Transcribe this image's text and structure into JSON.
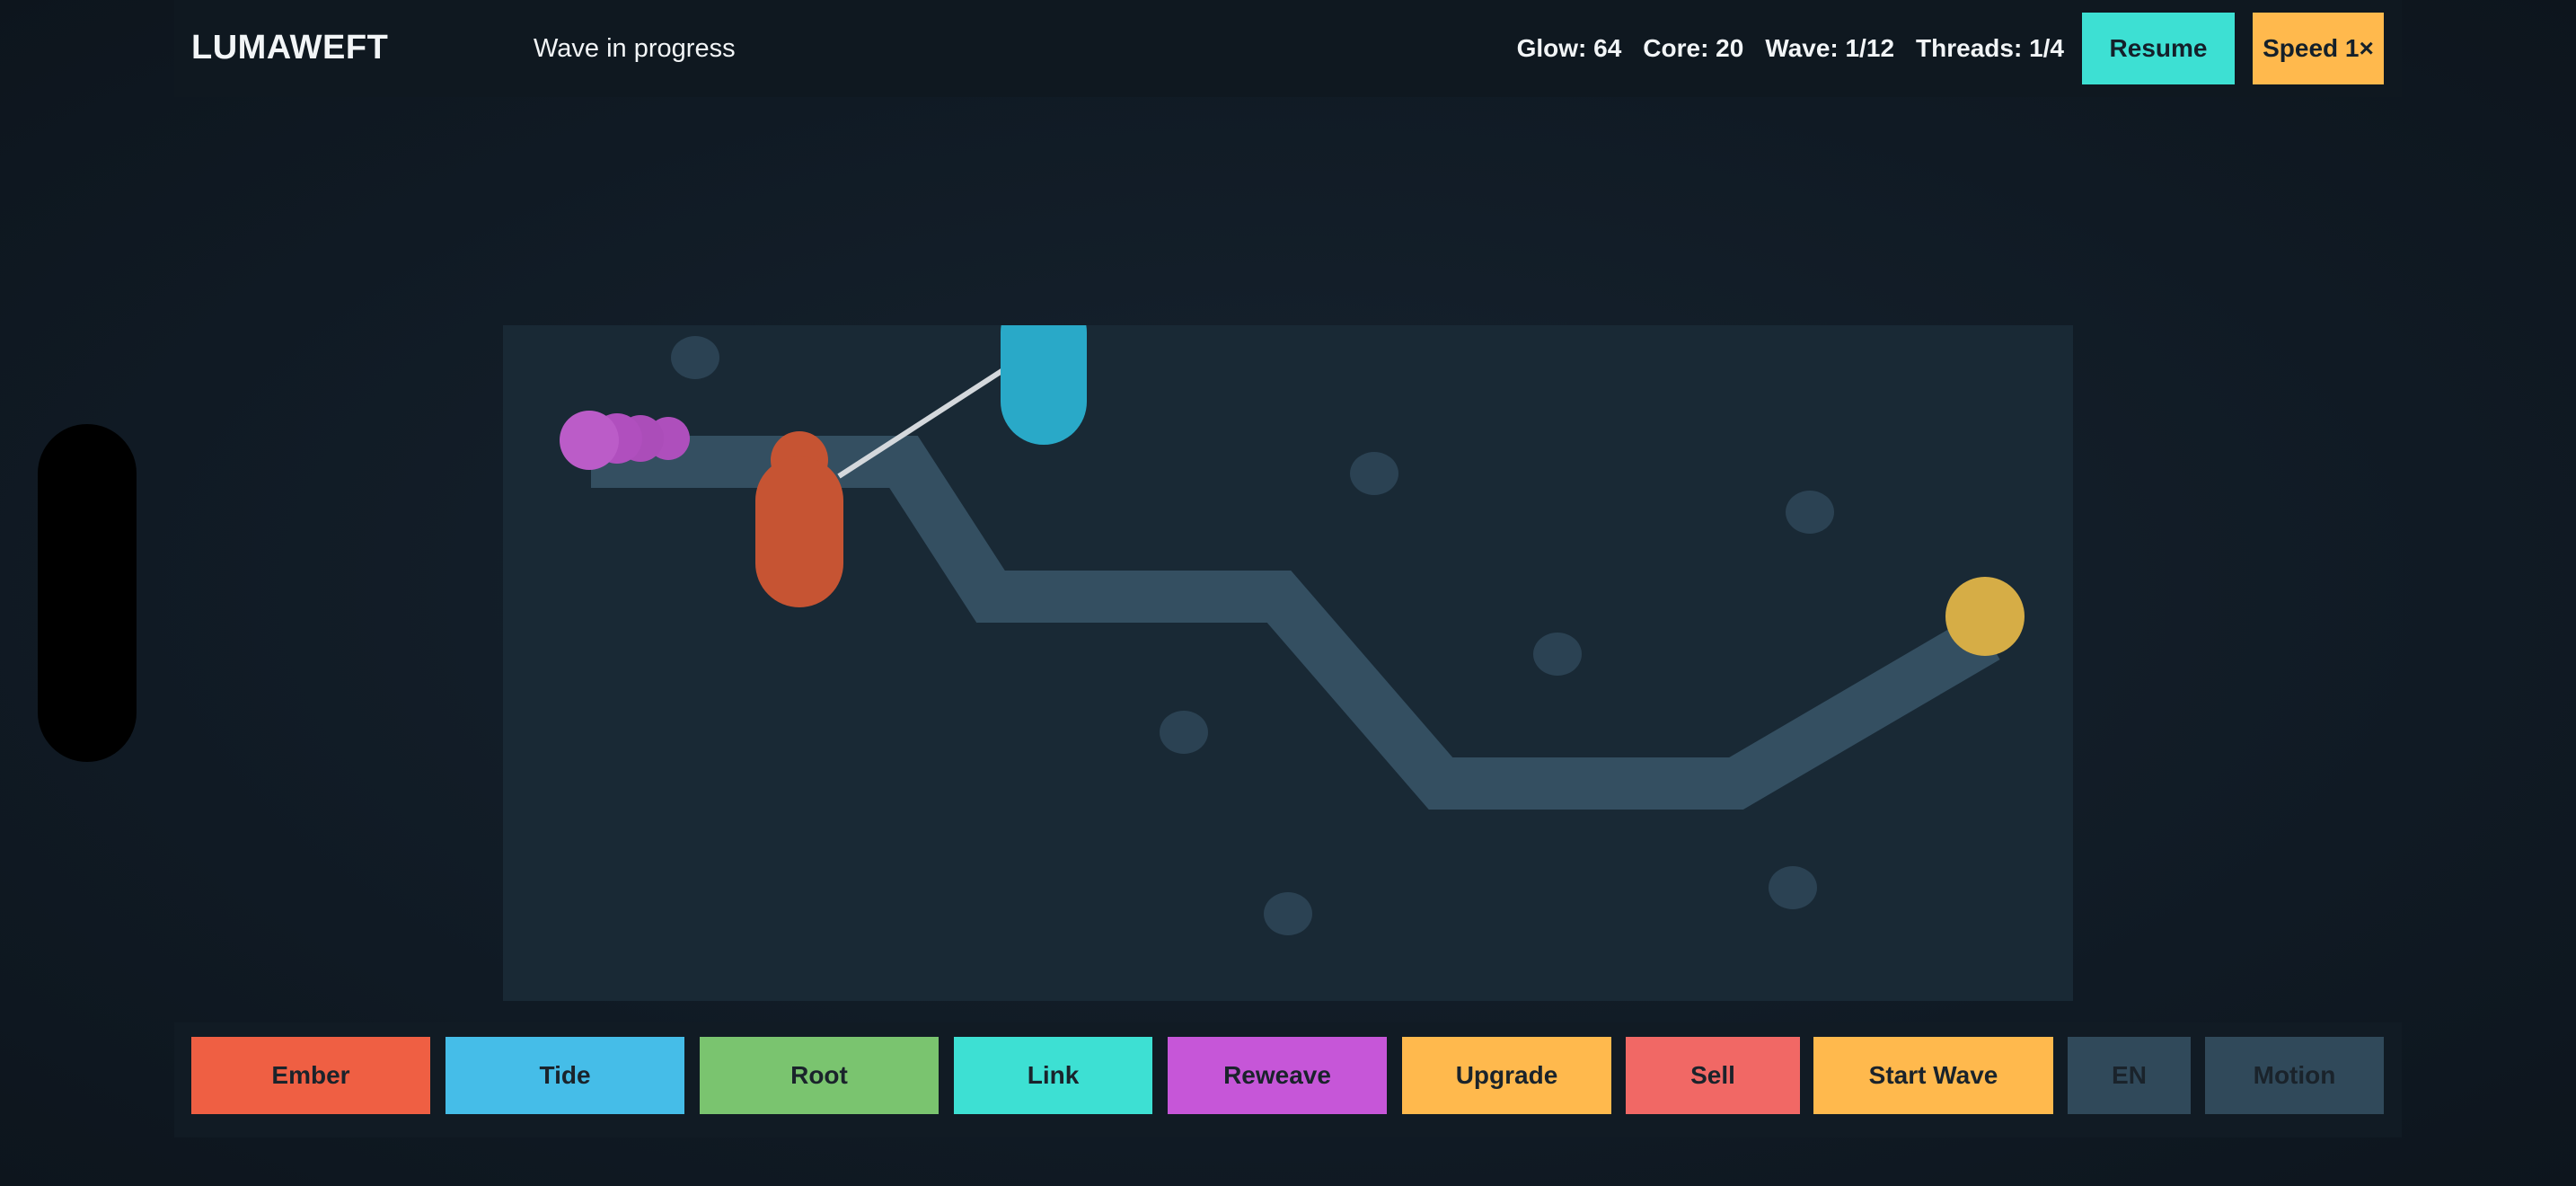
{
  "header": {
    "title": "LUMAWEFT",
    "status": "Wave in progress",
    "stats": {
      "glow": "Glow: 64",
      "core": "Core: 20",
      "wave": "Wave: 1/12",
      "threads": "Threads: 1/4"
    },
    "resume_label": "Resume",
    "speed_label": "Speed 1×"
  },
  "toolbar": {
    "ember": "Ember",
    "tide": "Tide",
    "root": "Root",
    "link": "Link",
    "reweave": "Reweave",
    "upgrade": "Upgrade",
    "sell": "Sell",
    "start_wave": "Start Wave",
    "language": "EN",
    "motion": "Motion"
  },
  "colors": {
    "ember": "#ef5f43",
    "tide": "#45bde8",
    "root": "#7ac46f",
    "link": "#3de0d3",
    "reweave": "#c656d8",
    "upgrade": "#ffb94d",
    "sell": "#f16865",
    "start_wave": "#ffb94d",
    "neutral": "#30495a",
    "board": "#192935",
    "path": "#344f61",
    "core": "#d6ad46"
  },
  "board": {
    "towers": [
      {
        "kind": "ember",
        "icon": "ember-tower-icon"
      },
      {
        "kind": "tide",
        "icon": "tide-tower-icon"
      }
    ],
    "enemies_visible": 5,
    "core_icon": "core-orb-icon"
  }
}
